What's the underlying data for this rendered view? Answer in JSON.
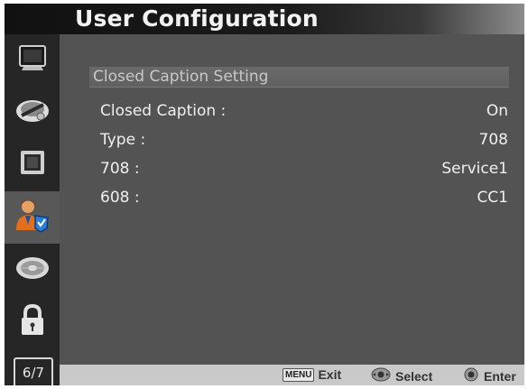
{
  "header": {
    "title": "User Configuration"
  },
  "sidebar": {
    "items": [
      {
        "icon": "monitor-icon",
        "active": false
      },
      {
        "icon": "color-wheel-icon",
        "active": false
      },
      {
        "icon": "picture-frame-icon",
        "active": false
      },
      {
        "icon": "user-config-icon",
        "active": true
      },
      {
        "icon": "disc-icon",
        "active": false
      },
      {
        "icon": "lock-icon",
        "active": false
      }
    ],
    "page_indicator": "6/7"
  },
  "main": {
    "section_title": "Closed Caption Setting",
    "settings": [
      {
        "label": "Closed Caption :",
        "value": "On"
      },
      {
        "label": "Type :",
        "value": "708"
      },
      {
        "label": "708 :",
        "value": "Service1"
      },
      {
        "label": "608 :",
        "value": "CC1"
      }
    ]
  },
  "footer": {
    "menu_key": "MENU",
    "exit_label": "Exit",
    "select_label": "Select",
    "enter_label": "Enter"
  },
  "colors": {
    "panel_bg": "#535353",
    "sidebar_bg": "#262626",
    "active_item_bg": "#585858",
    "footer_bg": "#c9c9c9",
    "text": "#f0f0f0"
  }
}
